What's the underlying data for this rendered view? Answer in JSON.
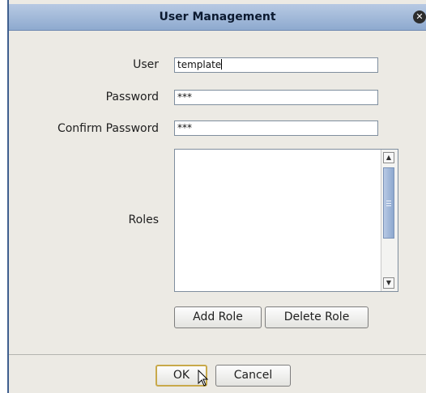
{
  "dialog": {
    "title": "User Management",
    "close_icon": "close-icon"
  },
  "form": {
    "user_label": "User",
    "user_value": "template",
    "password_label": "Password",
    "password_value": "***",
    "confirm_label": "Confirm Password",
    "confirm_value": "***",
    "roles_label": "Roles",
    "roles_items": []
  },
  "buttons": {
    "add_role": "Add Role",
    "delete_role": "Delete Role",
    "ok": "OK",
    "cancel": "Cancel"
  },
  "icons": {
    "cursor": "pointer-cursor-icon",
    "scroll_up": "scroll-up-icon",
    "scroll_down": "scroll-down-icon"
  },
  "colors": {
    "title_gradient_top": "#b7c9e3",
    "title_gradient_bottom": "#8eaacf",
    "dialog_bg": "#eceae4",
    "default_button_border": "#c8a94a"
  }
}
